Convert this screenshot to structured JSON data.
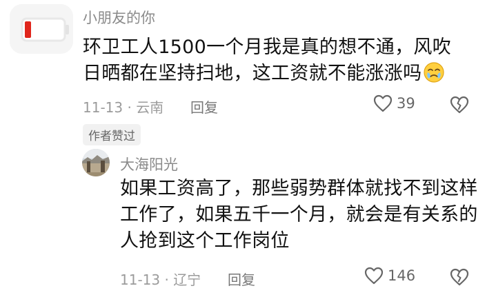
{
  "comment": {
    "username": "小朋友的你",
    "avatar_icon": "battery-low-icon",
    "text": "环卫工人1500一个月我是真的想不通，风吹日晒都在坚持扫地，这工资就不能涨涨吗",
    "emoji_icon": "crying-face-icon",
    "date_location": "11-13 · 云南",
    "reply_label": "回复",
    "like_count": "39",
    "badge": "作者赞过"
  },
  "reply": {
    "username": "大海阳光",
    "avatar_icon": "landscape-photo-icon",
    "text": "如果工资高了，那些弱势群体就找不到这样工作了，如果五千一个月，就会是有关系的人抢到这个工作岗位",
    "date_location": "11-13 · 辽宁",
    "reply_label": "回复",
    "like_count": "146"
  },
  "colors": {
    "battery_red": "#e0261c",
    "meta_gray": "#9b9b9b",
    "text": "#111111"
  }
}
